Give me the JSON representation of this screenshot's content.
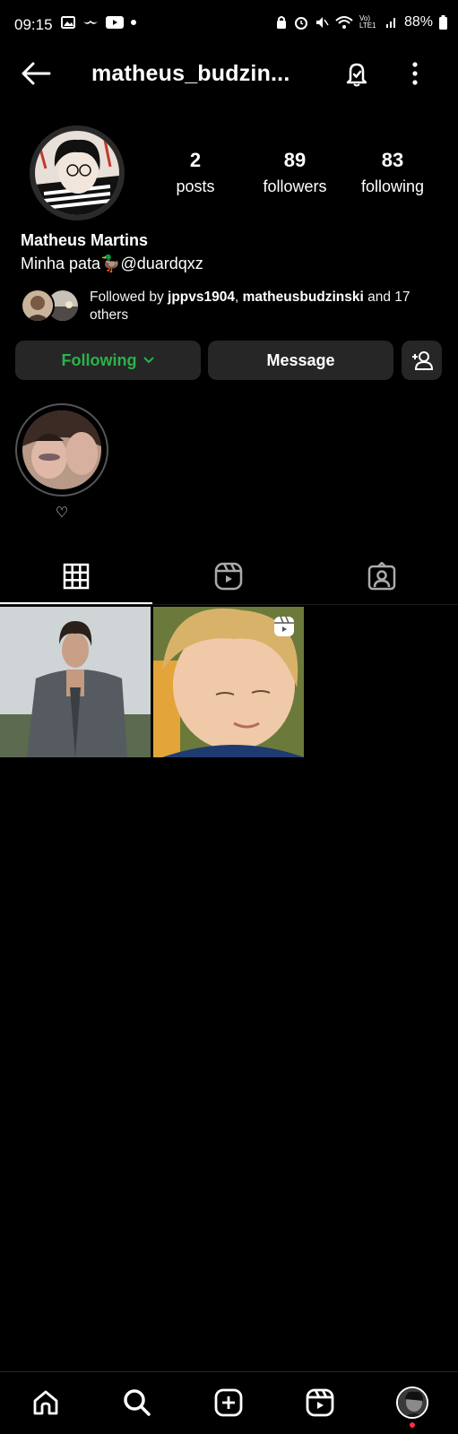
{
  "status_bar": {
    "time": "09:15",
    "battery": "88%",
    "network": "Vo) LTE1"
  },
  "header": {
    "username": "matheus_budzin...",
    "icons": [
      "back-arrow-icon",
      "notification-bell-icon",
      "more-options-icon"
    ]
  },
  "profile": {
    "stats": [
      {
        "value": "2",
        "label": "posts"
      },
      {
        "value": "89",
        "label": "followers"
      },
      {
        "value": "83",
        "label": "following"
      }
    ],
    "name": "Matheus Martins",
    "bio": "Minha pata🦆@duardqxz",
    "followed_by": {
      "prefix": "Followed by ",
      "user1": "jppvs1904",
      "sep": ", ",
      "user2": "matheusbudzinski",
      "suffix": " and 17 others"
    }
  },
  "actions": {
    "following_label": "Following",
    "message_label": "Message"
  },
  "highlights": [
    {
      "label": "♡"
    }
  ],
  "tabs": [
    "grid-icon",
    "reels-icon",
    "tagged-icon"
  ],
  "colors": {
    "background": "#000000",
    "button_bg": "#262626",
    "following_green": "#2bb24c",
    "notification_red": "#ff3040"
  }
}
